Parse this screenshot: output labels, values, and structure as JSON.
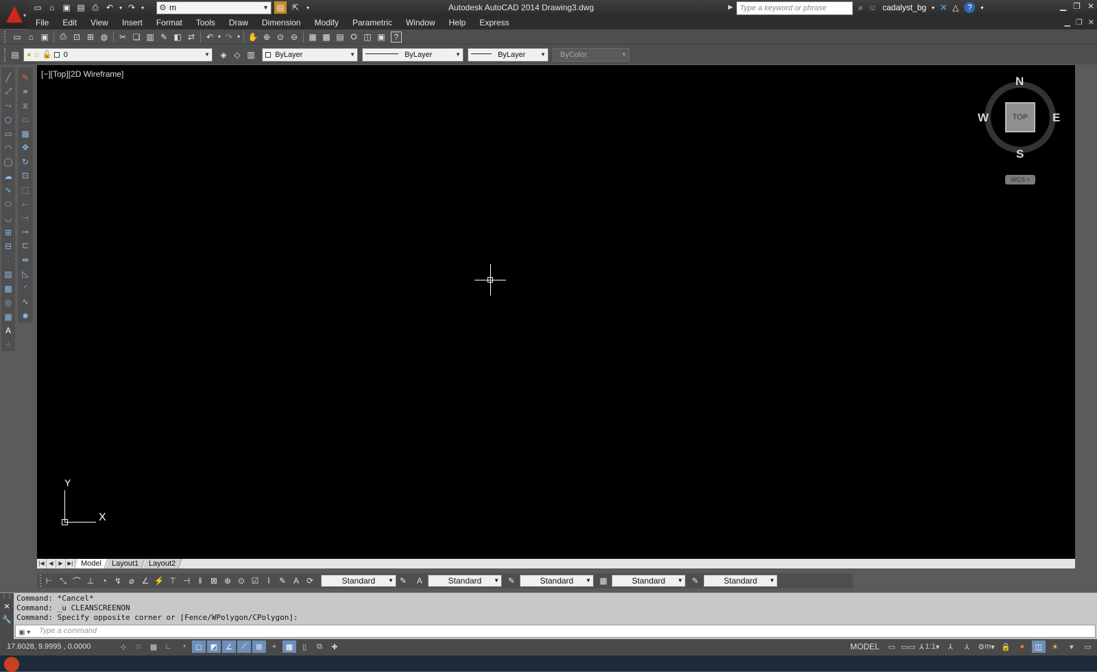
{
  "titlebar": {
    "workspace": "m",
    "title": "Autodesk AutoCAD 2014    Drawing3.dwg",
    "search_placeholder": "Type a keyword or phrase",
    "username": "cadalyst_bg"
  },
  "menu": [
    "File",
    "Edit",
    "View",
    "Insert",
    "Format",
    "Tools",
    "Draw",
    "Dimension",
    "Modify",
    "Parametric",
    "Window",
    "Help",
    "Express"
  ],
  "properties": {
    "layer": "0",
    "color": "ByLayer",
    "linetype": "ByLayer",
    "lineweight": "ByLayer",
    "plotstyle": "ByColor"
  },
  "viewport": {
    "label": "[−][Top][2D Wireframe]",
    "viewcube": {
      "face": "TOP",
      "north": "N",
      "south": "S",
      "east": "E",
      "west": "W",
      "wcs": "WCS ▿"
    },
    "ucs": {
      "x": "X",
      "y": "Y"
    }
  },
  "tabs": [
    "Model",
    "Layout1",
    "Layout2"
  ],
  "styles": {
    "dim_style": "Standard",
    "text_style": "Standard",
    "mleader_style": "Standard",
    "table_style": "Standard",
    "multileader_style": "Standard"
  },
  "command": {
    "history": [
      "Command: *Cancel*",
      "Command: _u CLEANSCREENON",
      "Command: Specify opposite corner or [Fence/WPolygon/CPolygon]:"
    ],
    "placeholder": "Type a command"
  },
  "status": {
    "coords": "17.6028, 9.9995 , 0.0000",
    "model": "MODEL",
    "annotation_scale": "1:1",
    "workspace": "m"
  },
  "colors": {
    "canvas": "#000000",
    "ui_dark": "#4e4e4e",
    "autocad_red": "#d0261c"
  }
}
